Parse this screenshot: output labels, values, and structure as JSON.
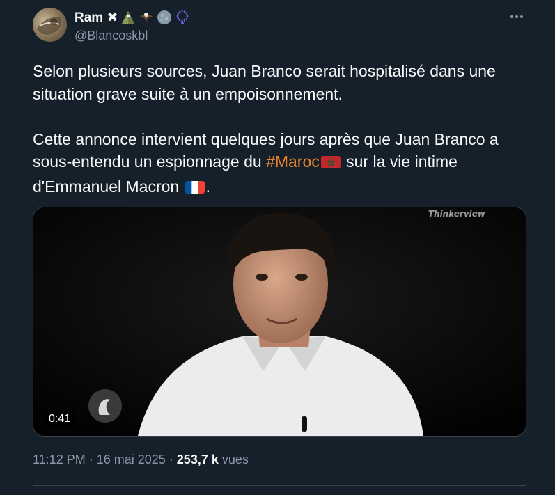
{
  "author": {
    "display_name": "Ram ✖",
    "handle": "@Blancoskbl",
    "badges": [
      "pyramid-icon",
      "eagle-icon",
      "globe-icon",
      "rosary-icon"
    ]
  },
  "tweet": {
    "line1": "Selon plusieurs sources, Juan Branco serait hospitalisé dans une situation grave suite à un empoisonnement.",
    "line2a": "Cette annonce intervient quelques jours après que Juan Branco a sous-entendu un espionnage du ",
    "hashtag": "#Maroc",
    "line2b": " sur la vie intime d'Emmanuel Macron ",
    "line2c": "."
  },
  "media": {
    "watermark": "Thinkerview",
    "duration": "0:41"
  },
  "meta": {
    "time": "11:12 PM",
    "sep1": "·",
    "date": "16 mai 2025",
    "sep2": "·",
    "views_count": "253,7 k",
    "views_label": "vues"
  },
  "colors": {
    "background": "#15202b",
    "hashtag": "#e8842c",
    "secondary_text": "#8b98a5"
  }
}
